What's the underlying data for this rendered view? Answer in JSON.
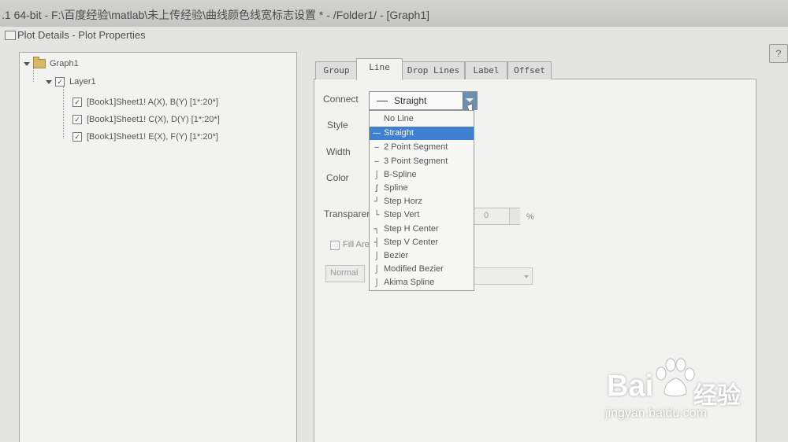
{
  "app": {
    "title": ".1 64-bit - F:\\百度经验\\matlab\\未上传经验\\曲线颜色线宽标志设置 * - /Folder1/ - [Graph1]"
  },
  "dialog": {
    "title": "Plot Details - Plot Properties",
    "help_label": "?"
  },
  "tree": {
    "root": "Graph1",
    "layer": "Layer1",
    "plots": [
      "[Book1]Sheet1! A(X), B(Y) [1*:20*]",
      "[Book1]Sheet1! C(X), D(Y) [1*:20*]",
      "[Book1]Sheet1! E(X), F(Y) [1*:20*]"
    ],
    "check_mark": "✓"
  },
  "tabs": [
    {
      "label": "Group",
      "active": false
    },
    {
      "label": "Line",
      "active": true
    },
    {
      "label": "Drop Lines",
      "active": false
    },
    {
      "label": "Label",
      "active": false
    },
    {
      "label": "Offset",
      "active": false
    }
  ],
  "props": {
    "connect_label": "Connect",
    "style_label": "Style",
    "width_label": "Width",
    "color_label": "Color",
    "transparency_label": "Transparer",
    "transparency_value": "0",
    "transparency_unit": "%",
    "fill_area_label": "Fill Are",
    "normal_label": "Normal"
  },
  "connect": {
    "value": "Straight",
    "options": [
      {
        "label": "No Line",
        "icon": "no-line-icon",
        "selected": false
      },
      {
        "label": "Straight",
        "icon": "straight-icon",
        "selected": true
      },
      {
        "label": "2 Point Segment",
        "icon": "two-point-segment-icon",
        "selected": false
      },
      {
        "label": "3 Point Segment",
        "icon": "three-point-segment-icon",
        "selected": false
      },
      {
        "label": "B-Spline",
        "icon": "b-spline-icon",
        "selected": false
      },
      {
        "label": "Spline",
        "icon": "spline-icon",
        "selected": false
      },
      {
        "label": "Step Horz",
        "icon": "step-horz-icon",
        "selected": false
      },
      {
        "label": "Step Vert",
        "icon": "step-vert-icon",
        "selected": false
      },
      {
        "label": "Step H Center",
        "icon": "step-h-center-icon",
        "selected": false
      },
      {
        "label": "Step V Center",
        "icon": "step-v-center-icon",
        "selected": false
      },
      {
        "label": "Bezier",
        "icon": "bezier-icon",
        "selected": false
      },
      {
        "label": "Modified Bezier",
        "icon": "modified-bezier-icon",
        "selected": false
      },
      {
        "label": "Akima Spline",
        "icon": "akima-spline-icon",
        "selected": false
      }
    ]
  },
  "watermark": {
    "brand": "Bai",
    "cn": "经验",
    "url": "jingyan.baidu.com"
  },
  "colors": {
    "selection": "#3f7fd0",
    "combo_arrow": "#6f8fb0"
  }
}
